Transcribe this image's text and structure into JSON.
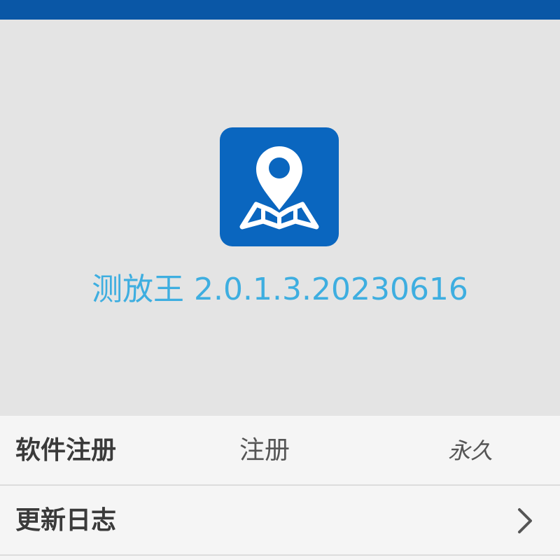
{
  "app": {
    "title": "测放王 2.0.1.3.20230616",
    "icon": "map-pin-icon",
    "accent_color": "#3eaee0",
    "icon_background": "#0a66bf",
    "top_bar_color": "#0a57a6"
  },
  "settings": {
    "register": {
      "label": "软件注册",
      "action": "注册",
      "status": "永久"
    },
    "changelog": {
      "label": "更新日志",
      "icon": "chevron-right-icon"
    }
  }
}
